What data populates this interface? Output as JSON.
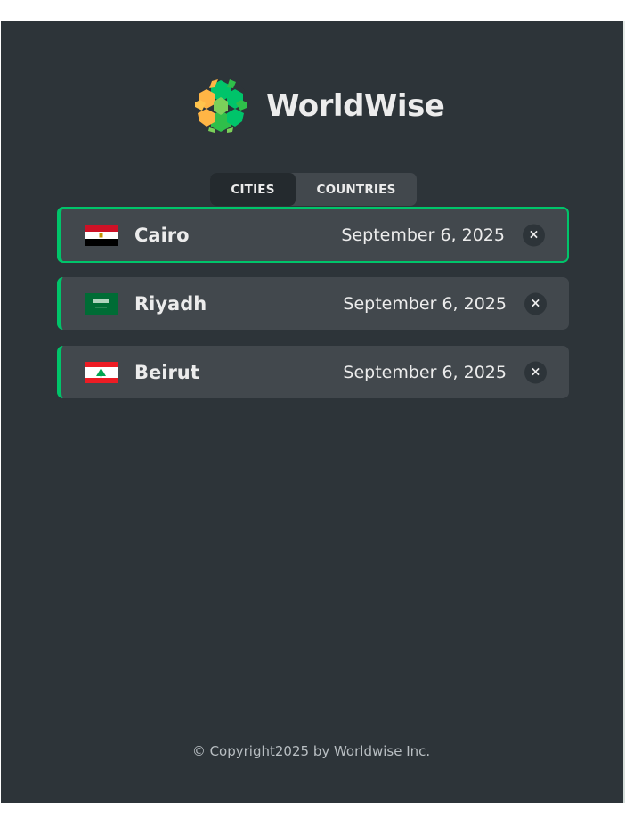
{
  "app": {
    "name": "WorldWise"
  },
  "tabs": {
    "cities_label": "CITIES",
    "countries_label": "COUNTRIES"
  },
  "cities": [
    {
      "name": "Cairo",
      "date": "September 6, 2025",
      "flag": "egypt-flag",
      "selected": true
    },
    {
      "name": "Riyadh",
      "date": "September 6, 2025",
      "flag": "saudi-arabia-flag",
      "selected": false
    },
    {
      "name": "Beirut",
      "date": "September 6, 2025",
      "flag": "lebanon-flag",
      "selected": false
    }
  ],
  "delete_symbol": "×",
  "footer": {
    "copyright": "© Copyright2025 by Worldwise Inc."
  },
  "colors": {
    "sidebar_bg": "#2d3439",
    "item_bg": "#42484d",
    "accent_green": "#00c46a",
    "text": "#ececec"
  }
}
